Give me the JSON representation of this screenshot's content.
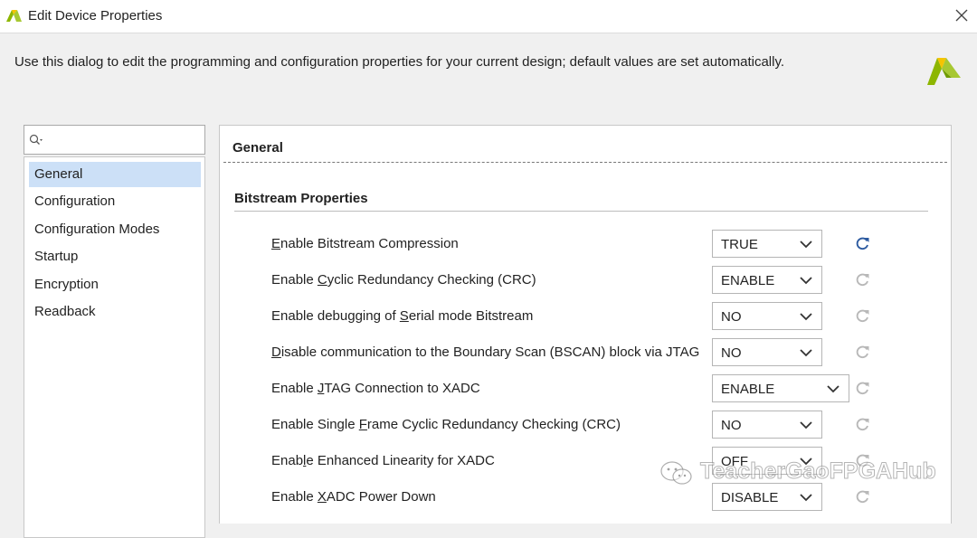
{
  "window": {
    "title": "Edit Device Properties",
    "description": "Use this dialog to edit the programming and configuration properties for your current design; default values are set automatically."
  },
  "search": {
    "placeholder": ""
  },
  "nav": {
    "items": [
      {
        "label": "General",
        "selected": true
      },
      {
        "label": "Configuration",
        "selected": false
      },
      {
        "label": "Configuration Modes",
        "selected": false
      },
      {
        "label": "Startup",
        "selected": false
      },
      {
        "label": "Encryption",
        "selected": false
      },
      {
        "label": "Readback",
        "selected": false
      }
    ]
  },
  "main": {
    "section_title": "General",
    "subsection_title": "Bitstream Properties",
    "properties": [
      {
        "pre": "",
        "u": "E",
        "post": "nable Bitstream Compression",
        "value": "TRUE",
        "reset_active": true
      },
      {
        "pre": "Enable ",
        "u": "C",
        "post": "yclic Redundancy Checking (CRC)",
        "value": "ENABLE",
        "reset_active": false
      },
      {
        "pre": "Enable debugging of ",
        "u": "S",
        "post": "erial mode Bitstream",
        "value": "NO",
        "reset_active": false
      },
      {
        "pre": "",
        "u": "D",
        "post": "isable communication to the Boundary Scan (BSCAN) block via JTAG",
        "value": "NO",
        "reset_active": false
      },
      {
        "pre": "Enable ",
        "u": "J",
        "post": "TAG Connection to XADC",
        "value": "ENABLE",
        "reset_active": false
      },
      {
        "pre": "Enable Single ",
        "u": "F",
        "post": "rame Cyclic Redundancy Checking (CRC)",
        "value": "NO",
        "reset_active": false
      },
      {
        "pre": "Enab",
        "u": "l",
        "post": "e Enhanced Linearity for XADC",
        "value": "OFF",
        "reset_active": false
      },
      {
        "pre": "Enable ",
        "u": "X",
        "post": "ADC Power Down",
        "value": "DISABLE",
        "reset_active": false
      }
    ]
  },
  "watermark": {
    "text": "TeacherGaoFPGAHub"
  },
  "colors": {
    "accent": "#2c5aa0",
    "selection": "#cce0f7",
    "logo_green": "#8db600",
    "logo_yellow": "#f5c400",
    "reset_disabled": "#b8b8b8"
  }
}
